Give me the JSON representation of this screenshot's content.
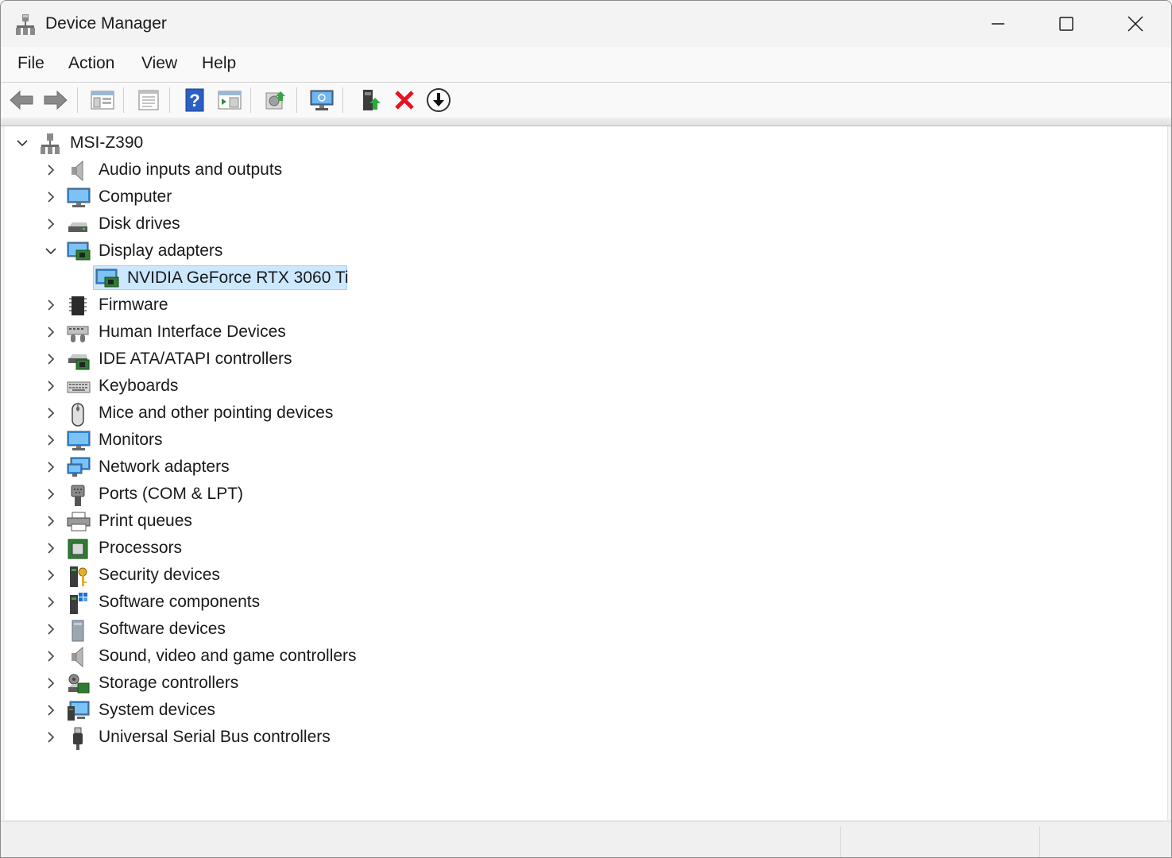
{
  "window": {
    "title": "Device Manager",
    "icon": "device-manager-icon"
  },
  "menu": {
    "items": [
      "File",
      "Action",
      "View",
      "Help"
    ]
  },
  "toolbar": {
    "buttons": [
      "back-arrow-icon",
      "forward-arrow-icon",
      "show-hide-console-tree-icon",
      "properties-icon",
      "help-icon",
      "show-action-pane-icon",
      "update-driver-icon",
      "scan-hardware-changes-icon",
      "add-legacy-hardware-icon",
      "uninstall-device-icon",
      "disable-device-icon"
    ]
  },
  "tree": {
    "root": {
      "label": "MSI-Z390",
      "expanded": true
    },
    "categories": [
      {
        "label": "Audio inputs and outputs",
        "icon": "speaker-icon",
        "expanded": false
      },
      {
        "label": "Computer",
        "icon": "monitor-icon",
        "expanded": false
      },
      {
        "label": "Disk drives",
        "icon": "disk-drive-icon",
        "expanded": false
      },
      {
        "label": "Display adapters",
        "icon": "display-adapter-icon",
        "expanded": true,
        "children": [
          {
            "label": "NVIDIA GeForce RTX 3060 Ti",
            "icon": "display-adapter-icon",
            "selected": true
          }
        ]
      },
      {
        "label": "Firmware",
        "icon": "firmware-chip-icon",
        "expanded": false
      },
      {
        "label": "Human Interface Devices",
        "icon": "hid-icon",
        "expanded": false
      },
      {
        "label": "IDE ATA/ATAPI controllers",
        "icon": "ide-controller-icon",
        "expanded": false
      },
      {
        "label": "Keyboards",
        "icon": "keyboard-icon",
        "expanded": false
      },
      {
        "label": "Mice and other pointing devices",
        "icon": "mouse-icon",
        "expanded": false
      },
      {
        "label": "Monitors",
        "icon": "monitor-icon",
        "expanded": false
      },
      {
        "label": "Network adapters",
        "icon": "network-adapter-icon",
        "expanded": false
      },
      {
        "label": "Ports (COM & LPT)",
        "icon": "port-icon",
        "expanded": false
      },
      {
        "label": "Print queues",
        "icon": "printer-icon",
        "expanded": false
      },
      {
        "label": "Processors",
        "icon": "processor-icon",
        "expanded": false
      },
      {
        "label": "Security devices",
        "icon": "security-key-icon",
        "expanded": false
      },
      {
        "label": "Software components",
        "icon": "software-component-icon",
        "expanded": false
      },
      {
        "label": "Software devices",
        "icon": "software-device-icon",
        "expanded": false
      },
      {
        "label": "Sound, video and game controllers",
        "icon": "speaker-icon",
        "expanded": false
      },
      {
        "label": "Storage controllers",
        "icon": "storage-controller-icon",
        "expanded": false
      },
      {
        "label": "System devices",
        "icon": "system-device-icon",
        "expanded": false
      },
      {
        "label": "Universal Serial Bus controllers",
        "icon": "usb-icon",
        "expanded": false
      }
    ]
  },
  "colors": {
    "selection_bg": "#cce8ff",
    "selection_border": "#99d1ff",
    "uninstall_red": "#e81123"
  }
}
